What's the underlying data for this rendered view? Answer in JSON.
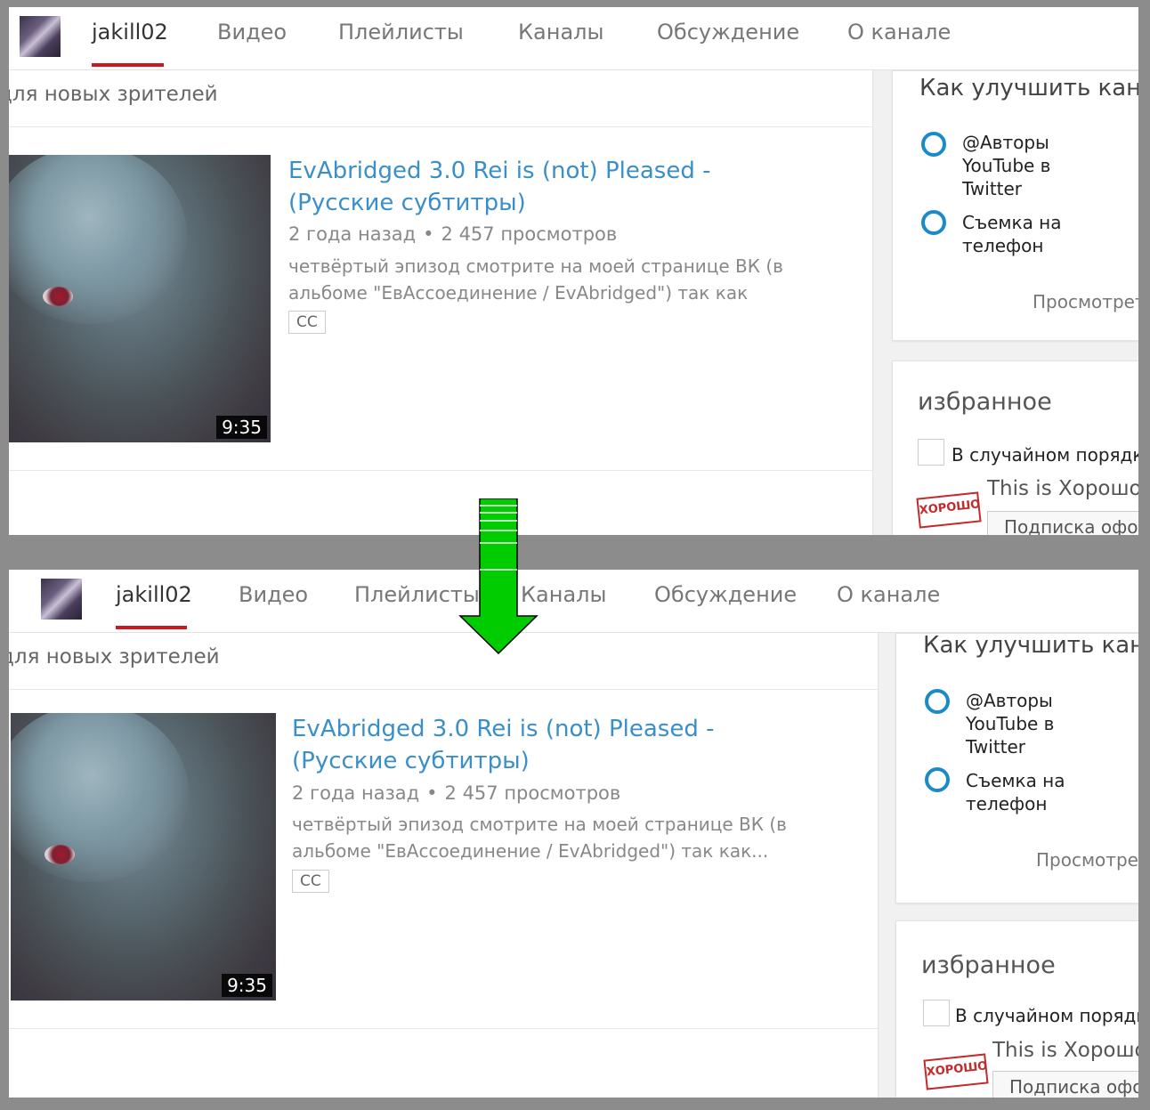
{
  "channel": {
    "name": "jakill02",
    "tabs": [
      "Видео",
      "Плейлисты",
      "Каналы",
      "Обсуждение",
      "О канале"
    ]
  },
  "main": {
    "section_title": "для новых зрителей",
    "video": {
      "title": "EvAbridged 3.0 Rei is (not) Pleased - (Русские субтитры)",
      "age": "2 года назад",
      "separator": "•",
      "views": "2 457 просмотров",
      "duration": "9:35",
      "badge": "CC"
    },
    "desc_before": "четвёртый эпизод смотрите на моей странице ВК (в альбоме \"ЕвАссоединение / EvAbridged\") так как",
    "desc_after": "четвёртый эпизод смотрите на моей странице ВК (в альбоме \"ЕвАссоединение / EvAbridged\") так как..."
  },
  "sidebar": {
    "improve_title": "Как улучшить кан",
    "improve_items": [
      "@Авторы YouTube в Twitter",
      "Съемка на телефон"
    ],
    "view_link": "Просмотрет",
    "favorites_title": "избранное",
    "shuffle_label": "В случайном порядк",
    "playlist_title": "This is Хорошо",
    "playlist_logo": "ХОРОШО",
    "subscribe_button": "Подписка офо"
  },
  "colors": {
    "accent_red": "#cc181e",
    "link_blue": "#3a8fc8",
    "bullet_blue": "#1a8bc8",
    "arrow_green": "#00cc00"
  }
}
